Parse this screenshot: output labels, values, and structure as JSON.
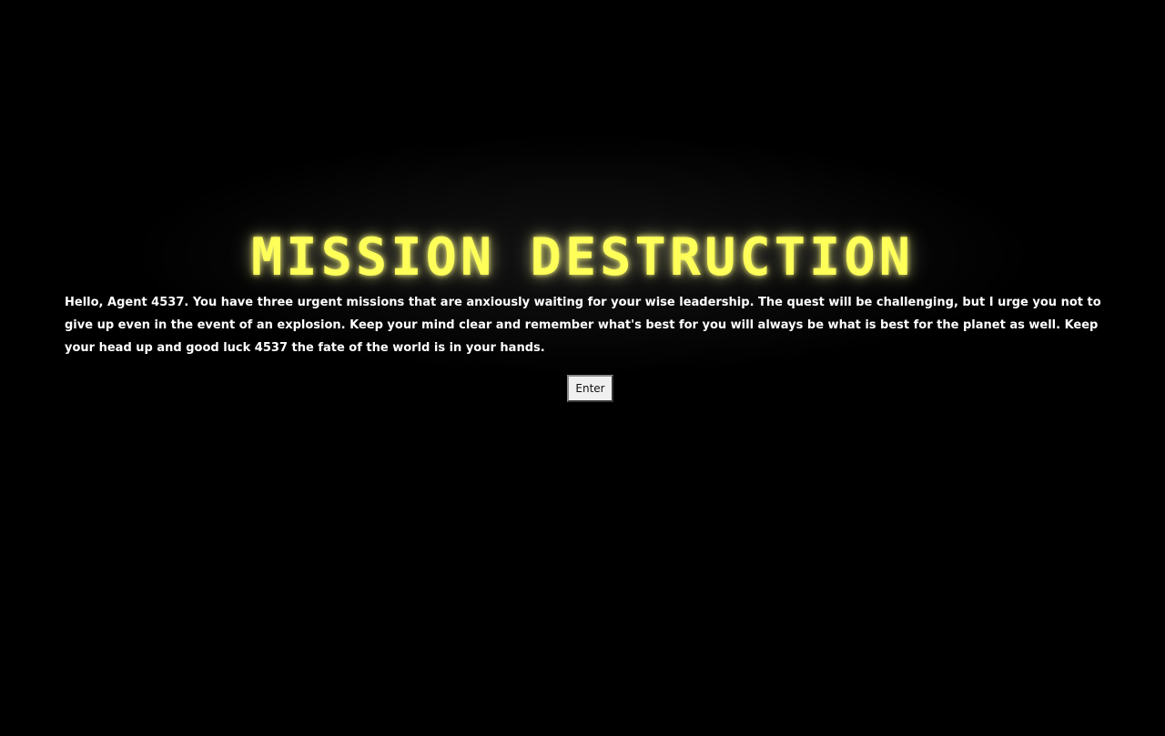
{
  "title": "MISSION DESTRUCTION",
  "intro_text": "Hello, Agent 4537. You have three urgent missions that are anxiously waiting for your wise leadership. The quest will be challenging, but I urge you not to give up even in the event of an explosion. Keep your mind clear and remember what's best for you will always be what is best for the planet as well. Keep your head up and good luck 4537 the fate of the world is in your hands.",
  "enter_button": "Enter",
  "colors": {
    "background": "#000000",
    "title": "#ffff5a",
    "text": "#ffffff"
  }
}
